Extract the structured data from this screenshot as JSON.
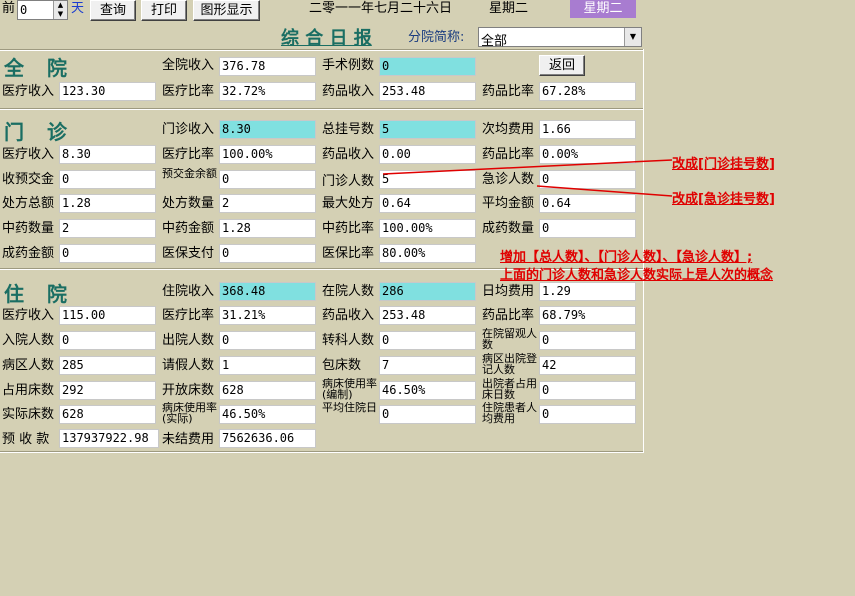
{
  "toolbar": {
    "prev_label": "前",
    "days_value": "0",
    "days_unit": "天",
    "query_label": "查询",
    "print_label": "打印",
    "graph_label": "图形显示",
    "date_text": "二零一一年七月二十六日",
    "weekday_text": "星期二",
    "weekday_badge": "星期二"
  },
  "header": {
    "title": "综 合 日 报",
    "branch_label": "分院简称:",
    "branch_value": "全部",
    "back_label": "返回"
  },
  "sections": {
    "quanyuan": "全 院",
    "menzhen": "门 诊",
    "zhuyuan": "住 院"
  },
  "quanyuan": {
    "total_income_label": "全院收入",
    "total_income": "376.78",
    "surgery_label": "手术例数",
    "surgery": "0",
    "medical_income_label": "医疗收入",
    "medical_income": "123.30",
    "medical_ratio_label": "医疗比率",
    "medical_ratio": "32.72%",
    "drug_income_label": "药品收入",
    "drug_income": "253.48",
    "drug_ratio_label": "药品比率",
    "drug_ratio": "67.28%"
  },
  "menzhen": {
    "op_income_label": "门诊收入",
    "op_income": "8.30",
    "reg_total_label": "总挂号数",
    "reg_total": "5",
    "avg_cost_label": "次均费用",
    "avg_cost": "1.66",
    "medical_income_label": "医疗收入",
    "medical_income": "8.30",
    "medical_ratio_label": "医疗比率",
    "medical_ratio": "100.00%",
    "drug_income_label": "药品收入",
    "drug_income": "0.00",
    "drug_ratio_label": "药品比率",
    "drug_ratio": "0.00%",
    "prepay_label": "收预交金",
    "prepay": "0",
    "prepay_balance_label": "预交金余额",
    "prepay_balance": "0",
    "op_people_label": "门诊人数",
    "op_people": "5",
    "er_people_label": "急诊人数",
    "er_people": "0",
    "rx_total_label": "处方总额",
    "rx_total": "1.28",
    "rx_count_label": "处方数量",
    "rx_count": "2",
    "max_rx_label": "最大处方",
    "max_rx": "0.64",
    "avg_amount_label": "平均金额",
    "avg_amount": "0.64",
    "tcm_count_label": "中药数量",
    "tcm_count": "2",
    "tcm_amount_label": "中药金额",
    "tcm_amount": "1.28",
    "tcm_ratio_label": "中药比率",
    "tcm_ratio": "100.00%",
    "patent_count_label": "成药数量",
    "patent_count": "0",
    "patent_amount_label": "成药金额",
    "patent_amount": "0",
    "insurance_label": "医保支付",
    "insurance": "0",
    "insurance_ratio_label": "医保比率",
    "insurance_ratio": "80.00%"
  },
  "zhuyuan": {
    "ip_income_label": "住院收入",
    "ip_income": "368.48",
    "inpatients_label": "在院人数",
    "inpatients": "286",
    "daily_cost_label": "日均费用",
    "daily_cost": "1.29",
    "medical_income_label": "医疗收入",
    "medical_income": "115.00",
    "medical_ratio_label": "医疗比率",
    "medical_ratio": "31.21%",
    "drug_income_label": "药品收入",
    "drug_income": "253.48",
    "drug_ratio_label": "药品比率",
    "drug_ratio": "68.79%",
    "admit_label": "入院人数",
    "admit": "0",
    "discharge_label": "出院人数",
    "discharge": "0",
    "transfer_label": "转科人数",
    "transfer": "0",
    "observe_label": "在院留观人数",
    "observe": "0",
    "ward_people_label": "病区人数",
    "ward_people": "285",
    "leave_label": "请假人数",
    "leave": "1",
    "bed_package_label": "包床数",
    "bed_package": "7",
    "ward_discharge_reg_label": "病区出院登记人数",
    "ward_discharge_reg": "42",
    "occupied_beds_label": "占用床数",
    "occupied_beds": "292",
    "open_beds_label": "开放床数",
    "open_beds": "628",
    "bed_rate_staff_label": "病床使用率(编制)",
    "bed_rate_staff": "46.50%",
    "discharged_bed_days_label": "出院者占用床日数",
    "discharged_bed_days": "0",
    "actual_beds_label": "实际床数",
    "actual_beds": "628",
    "bed_rate_actual_label": "病床使用率(实际)",
    "bed_rate_actual": "46.50%",
    "avg_stay_label": "平均住院日",
    "avg_stay": "0",
    "inpatient_avg_cost_label": "住院患者人均费用",
    "inpatient_avg_cost": "0",
    "deposit_label": "预 收 款",
    "deposit": "137937922.98",
    "unsettled_label": "未结费用",
    "unsettled": "7562636.06"
  },
  "annotations": {
    "note1": "改成[门诊挂号数]",
    "note2": "改成[急诊挂号数]",
    "note3_line1": "增加【总人数】、【门诊人数】、【急诊人数】;",
    "note3_line2": "上面的门诊人数和急诊人数实际上是人次的概念"
  },
  "colors": {
    "background": "#d4d0b4",
    "highlight_field": "#80e0e0",
    "section_title": "#1a6e63",
    "annotation": "#e00000",
    "weekday_badge": "#a87cd0"
  }
}
